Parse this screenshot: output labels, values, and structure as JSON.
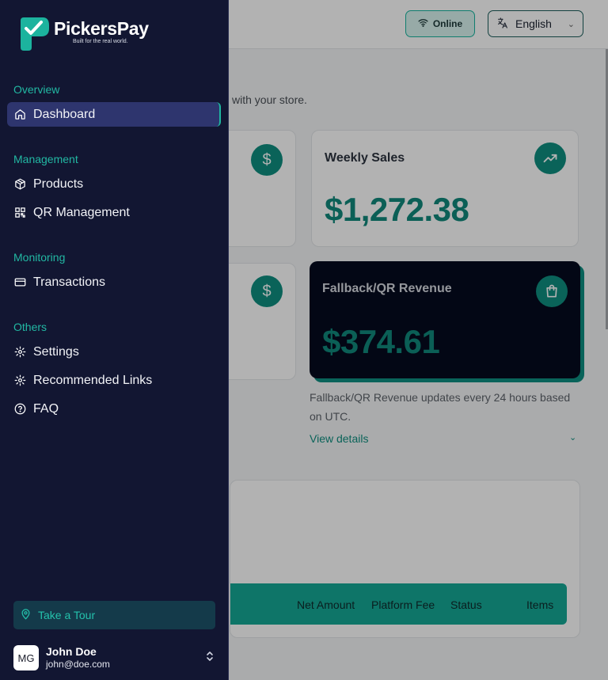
{
  "header": {
    "status_label": "Online",
    "language": "English"
  },
  "dashboard": {
    "welcome_subtitle": "with your store.",
    "cards": [
      {
        "title": "Weekly Sales",
        "value": "$1,272.38"
      },
      {
        "title": "Fallback/QR Revenue",
        "value": "$374.61"
      }
    ],
    "fallback_note": "Fallback/QR Revenue updates every 24 hours based on UTC.",
    "view_details": "View details",
    "table_headers": [
      "Net Amount",
      "Platform Fee",
      "Status",
      "Items"
    ]
  },
  "sidebar": {
    "brand": "PickersPay",
    "tagline": "Built for the real world.",
    "sections": {
      "overview": "Overview",
      "management": "Management",
      "monitoring": "Monitoring",
      "others": "Others"
    },
    "items": {
      "dashboard": "Dashboard",
      "products": "Products",
      "qr_management": "QR Management",
      "transactions": "Transactions",
      "settings": "Settings",
      "recommended_links": "Recommended Links",
      "faq": "FAQ"
    },
    "tour_button": "Take a Tour",
    "user": {
      "initials": "MG",
      "name": "John Doe",
      "email": "john@doe.com"
    }
  },
  "colors": {
    "sidebar_bg": "#121632",
    "accent": "#0f8f80",
    "active_item_bg": "#2e356e",
    "dark_card_bg": "#050b1f"
  }
}
